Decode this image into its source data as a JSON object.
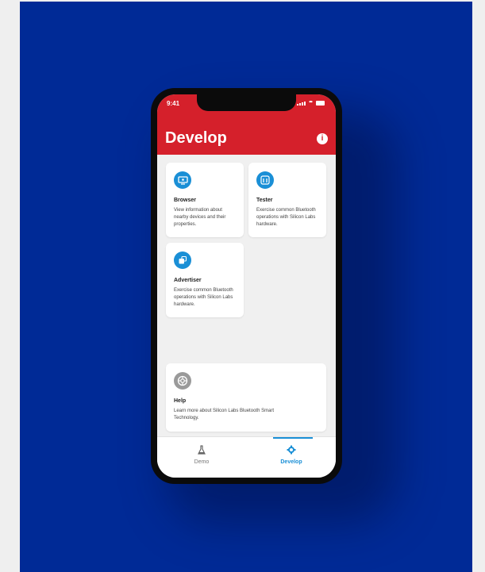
{
  "status_bar": {
    "time": "9:41"
  },
  "header": {
    "title": "Develop",
    "info_icon": "info-icon"
  },
  "cards": [
    {
      "title": "Browser",
      "description": "View information about nearby devices and their properties.",
      "icon": "browser-icon"
    },
    {
      "title": "Tester",
      "description": "Exercise common Bluetooth operations with Silicon Labs hardware.",
      "icon": "tester-icon"
    },
    {
      "title": "Advertiser",
      "description": "Exercise common Bluetooth operations with Silicon Labs hardware.",
      "icon": "advertiser-icon"
    },
    {
      "title": "Help",
      "description": "Learn more about Silicon Labs Bluetooth Smart Technology.",
      "icon": "help-icon"
    }
  ],
  "tabs": [
    {
      "label": "Demo",
      "icon": "flask-icon",
      "active": false
    },
    {
      "label": "Develop",
      "icon": "gear-icon",
      "active": true
    }
  ],
  "colors": {
    "background": "#002a96",
    "header": "#d5202b",
    "accent": "#1a8fd6",
    "page_margin": "#efefef"
  }
}
